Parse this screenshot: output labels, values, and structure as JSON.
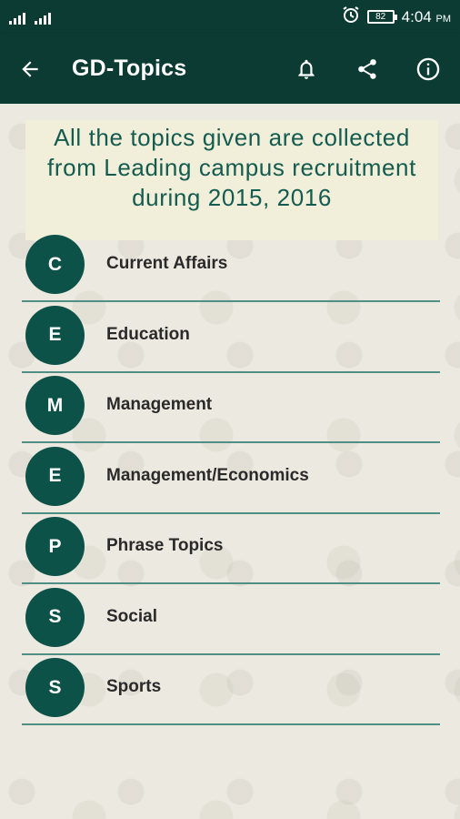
{
  "status_bar": {
    "time": "4:04",
    "ampm": "PM",
    "battery": "82"
  },
  "app_bar": {
    "title": "GD-Topics",
    "back_icon": "arrow-left-icon",
    "notification_icon": "bell-icon",
    "share_icon": "share-icon",
    "info_icon": "info-icon"
  },
  "banner": {
    "line1": "All the topics given are collected",
    "line2": "from Leading campus recruitment",
    "line3": "during 2015, 2016"
  },
  "topics": [
    {
      "letter": "C",
      "label": "Current Affairs"
    },
    {
      "letter": "E",
      "label": "Education"
    },
    {
      "letter": "M",
      "label": "Management"
    },
    {
      "letter": "E",
      "label": "Management/Economics"
    },
    {
      "letter": "P",
      "label": "Phrase Topics"
    },
    {
      "letter": "S",
      "label": "Social"
    },
    {
      "letter": "S",
      "label": "Sports"
    }
  ],
  "colors": {
    "primary": "#0b3b33",
    "avatar": "#0d5248",
    "banner_text": "#145b50",
    "divider": "#4f8f86"
  }
}
